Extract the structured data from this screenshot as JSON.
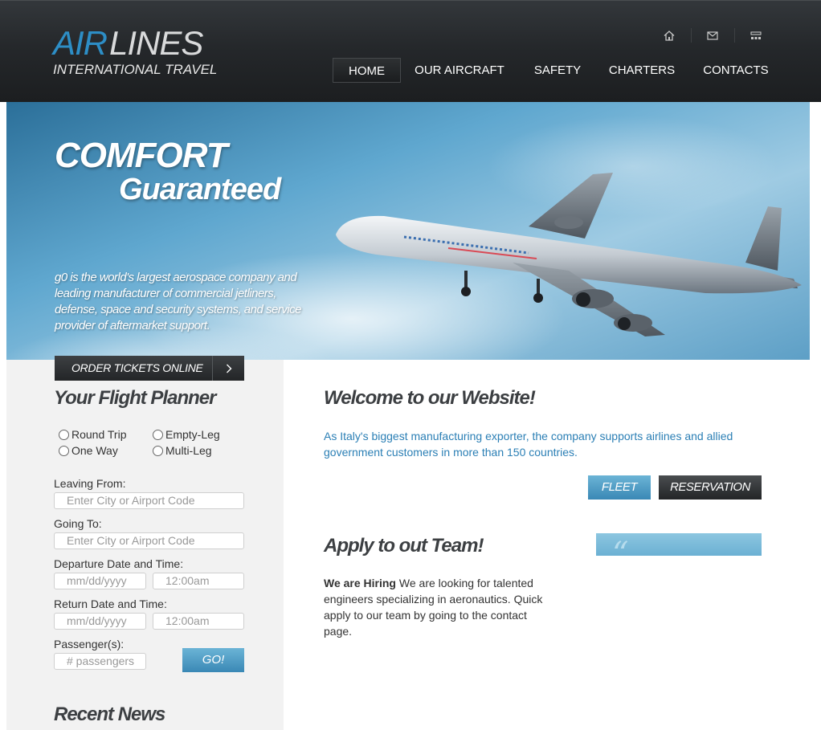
{
  "logo": {
    "air": "AIR",
    "lines": "LINES",
    "subtitle": "INTERNATIONAL TRAVEL"
  },
  "utility_icons": [
    "home-icon",
    "mail-icon",
    "sitemap-icon"
  ],
  "nav": {
    "items": [
      {
        "label": "HOME",
        "active": true
      },
      {
        "label": "OUR AIRCRAFT",
        "active": false
      },
      {
        "label": "SAFETY",
        "active": false
      },
      {
        "label": "CHARTERS",
        "active": false
      },
      {
        "label": "CONTACTS",
        "active": false
      }
    ]
  },
  "hero": {
    "headline": "COMFORT",
    "subheadline": "Guaranteed",
    "text": "g0 is the world's largest aerospace company and leading manufacturer of commercial jetliners, defense, space and security systems, and service provider of aftermarket support."
  },
  "sidebar": {
    "order_button": "ORDER TICKETS ONLINE",
    "planner_title": "Your Flight Planner",
    "trip_types": [
      {
        "label": "Round Trip"
      },
      {
        "label": "Empty-Leg"
      },
      {
        "label": "One Way"
      },
      {
        "label": "Multi-Leg"
      }
    ],
    "leaving_label": "Leaving From:",
    "leaving_placeholder": "Enter City or Airport Code",
    "going_label": "Going To:",
    "going_placeholder": "Enter City or Airport Code",
    "departure_label": "Departure Date and Time:",
    "departure_date_placeholder": "mm/dd/yyyy",
    "departure_time_placeholder": "12:00am",
    "return_label": "Return Date and Time:",
    "return_date_placeholder": "mm/dd/yyyy",
    "return_time_placeholder": "12:00am",
    "passengers_label": "Passenger(s):",
    "passengers_placeholder": "# passengers",
    "go_button": "GO!",
    "news_title": "Recent News"
  },
  "main": {
    "welcome_title": "Welcome to our Website!",
    "welcome_text": "As Italy's biggest manufacturing exporter, the company supports airlines and allied government customers in more than 150 countries.",
    "fleet_button": "FLEET",
    "reservation_button": "RESERVATION",
    "apply_title": "Apply to out Team!",
    "apply_bold": "We are Hiring",
    "apply_text": " We are looking for talented engineers specializing in aeronautics. Quick apply to our team by going to the contact page."
  },
  "colors": {
    "accent_blue": "#2b7fb5",
    "header_dark": "#25282b",
    "button_blue": "#3a88b5",
    "sidebar_bg": "#f2f2f2"
  }
}
